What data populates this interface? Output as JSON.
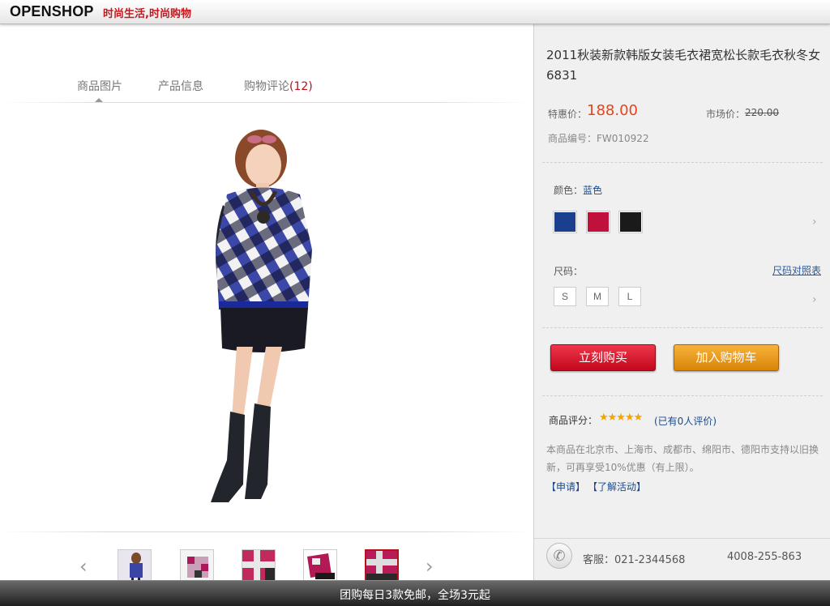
{
  "header": {
    "brand": "OPENSHOP",
    "slogan": "时尚生活,时尚购物"
  },
  "tabs": [
    {
      "label": "商品图片",
      "count": ""
    },
    {
      "label": "产品信息",
      "count": ""
    },
    {
      "label": "购物评论",
      "count": "(12)"
    }
  ],
  "thumbnails": {
    "prev_icon": "chevron-left-icon",
    "next_icon": "chevron-right-icon",
    "count": 5,
    "active_index": 4
  },
  "product": {
    "title": "2011秋装新款韩版女装毛衣裙宽松长款毛衣秋冬女6831",
    "price_label": "特惠价：",
    "price": "188.00",
    "market_label": "市场价：",
    "market_price": "220.00",
    "sku": "商品编号：FW010922",
    "color_label": "颜色：",
    "color_value": "蓝色",
    "colors": [
      "#1a3f8f",
      "#c0103c",
      "#1a1a1a"
    ],
    "size_label": "尺码：",
    "size_chart_link": "尺码对照表",
    "sizes": [
      "S",
      "M",
      "L"
    ],
    "buy_button": "立刻购买",
    "cart_button": "加入购物车",
    "rating_label": "商品评分：",
    "rating_stars": 5,
    "rating_count": "(已有0人评价)",
    "notice": "本商品在北京市、上海市、成都市、绵阳市、德阳市支持以旧换新，可再享受10%优惠（有上限）。",
    "apply_link": "【申请】",
    "learn_link": "【了解活动】",
    "service": "客服：021-2344568",
    "hotline": "4008-255-863"
  },
  "footer": {
    "promo": "团购每日3款免邮，全场3元起"
  },
  "colors": {
    "accent": "#c8161d",
    "price": "#e4451c",
    "link": "#1a4a8c",
    "buy": "#d01527",
    "cart": "#eca02a"
  }
}
